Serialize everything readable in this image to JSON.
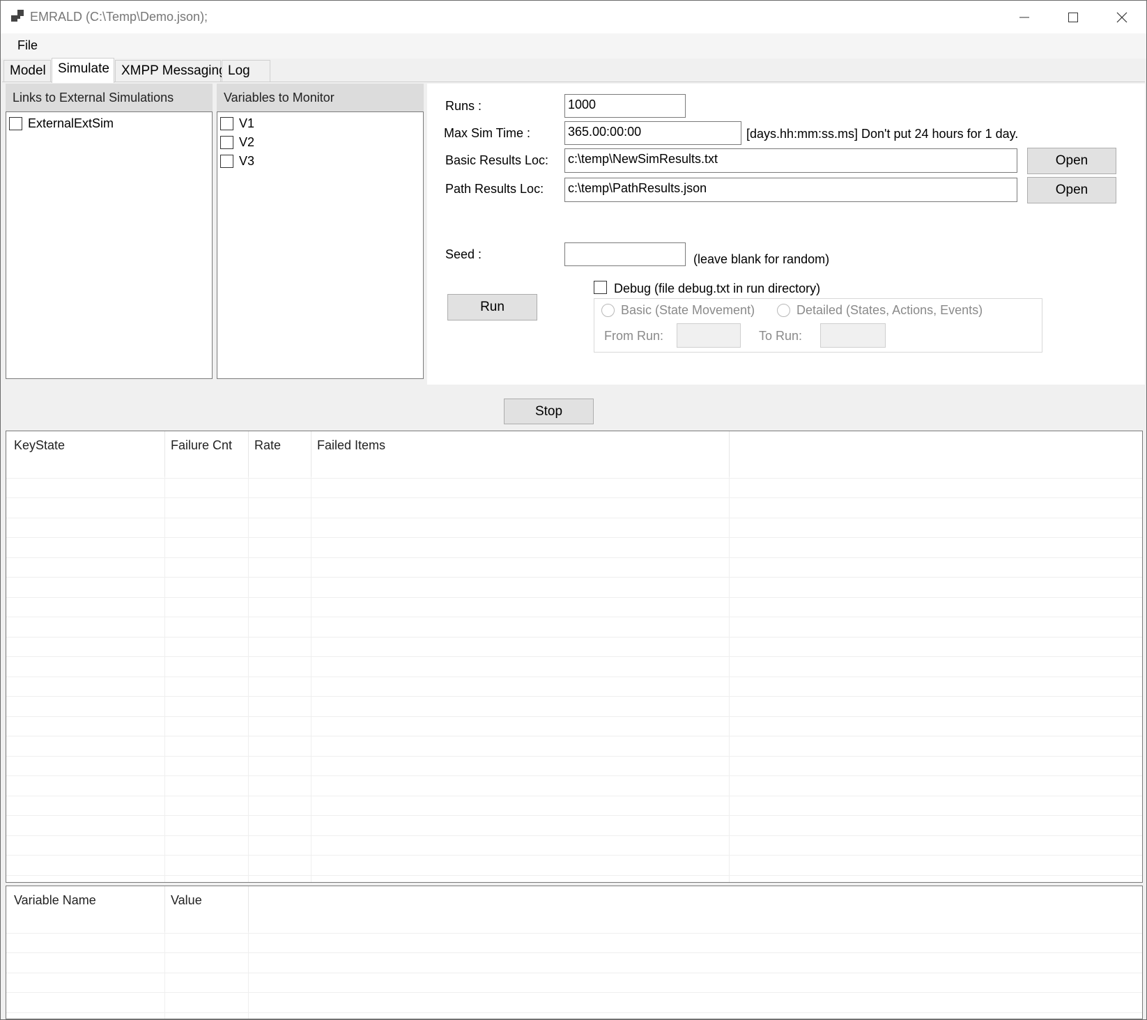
{
  "window": {
    "title": "EMRALD (C:\\Temp\\Demo.json);",
    "icon": "app-window-icon",
    "controls": [
      "minimize-icon",
      "maximize-icon",
      "close-icon"
    ]
  },
  "menu": {
    "file": "File"
  },
  "tabs": [
    {
      "label": "Model",
      "active": false
    },
    {
      "label": "Simulate",
      "active": true
    },
    {
      "label": "XMPP Messaging",
      "active": false
    },
    {
      "label": "Log",
      "active": false
    }
  ],
  "links_panel": {
    "header": "Links to External Simulations",
    "items": [
      {
        "label": "ExternalExtSim",
        "checked": false
      }
    ]
  },
  "variables_panel": {
    "header": "Variables to Monitor",
    "items": [
      {
        "label": "V1",
        "checked": false
      },
      {
        "label": "V2",
        "checked": false
      },
      {
        "label": "V3",
        "checked": false
      }
    ]
  },
  "settings": {
    "runs_label": "Runs :",
    "runs_value": "1000",
    "max_sim_time_label": "Max Sim Time :",
    "max_sim_time_value": "365.00:00:00",
    "max_sim_time_hint": "[days.hh:mm:ss.ms]  Don't put 24 hours for 1 day.",
    "basic_results_label": "Basic Results Loc:",
    "basic_results_value": "c:\\temp\\NewSimResults.txt",
    "path_results_label": "Path Results Loc:",
    "path_results_value": "c:\\temp\\PathResults.json",
    "open_label": "Open",
    "seed_label": "Seed :",
    "seed_value": "",
    "seed_hint": "(leave blank for random)",
    "run_label": "Run",
    "debug_label": "Debug (file debug.txt in run directory)",
    "debug_checked": false,
    "basic_option": "Basic (State Movement)",
    "detailed_option": "Detailed (States, Actions, Events)",
    "from_run_label": "From Run:",
    "from_run_value": "",
    "to_run_label": "To Run:",
    "to_run_value": ""
  },
  "stop_label": "Stop",
  "results_grid": {
    "columns": [
      "KeyState",
      "Failure Cnt",
      "Rate",
      "Failed Items"
    ],
    "rows": []
  },
  "variables_grid": {
    "columns": [
      "Variable Name",
      "Value"
    ],
    "rows": []
  }
}
